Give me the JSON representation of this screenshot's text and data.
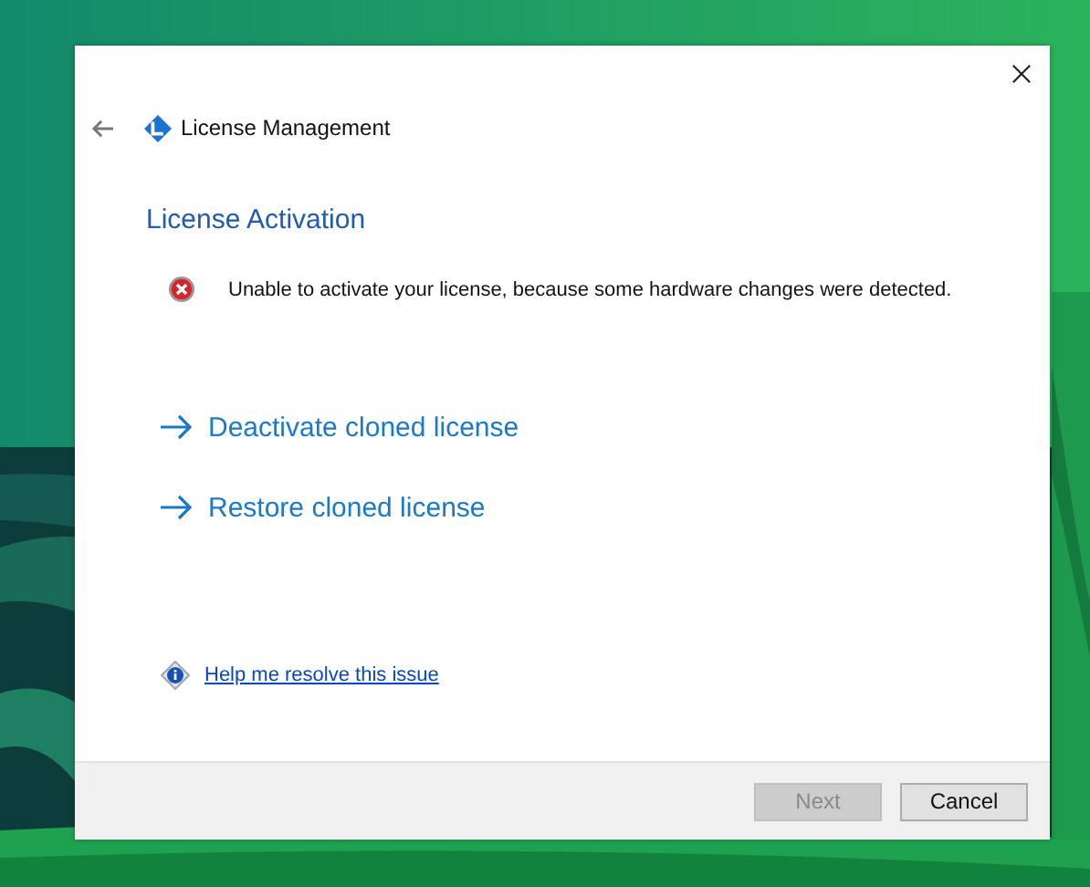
{
  "window": {
    "title": "License Management"
  },
  "heading": "License Activation",
  "error": "Unable to activate your license, because some hardware changes were detected.",
  "links": [
    {
      "label": "Deactivate cloned license"
    },
    {
      "label": "Restore cloned license"
    }
  ],
  "help_link": "Help me resolve this issue",
  "buttons": [
    {
      "label": "Next",
      "disabled": true
    },
    {
      "label": "Cancel",
      "disabled": false
    }
  ]
}
